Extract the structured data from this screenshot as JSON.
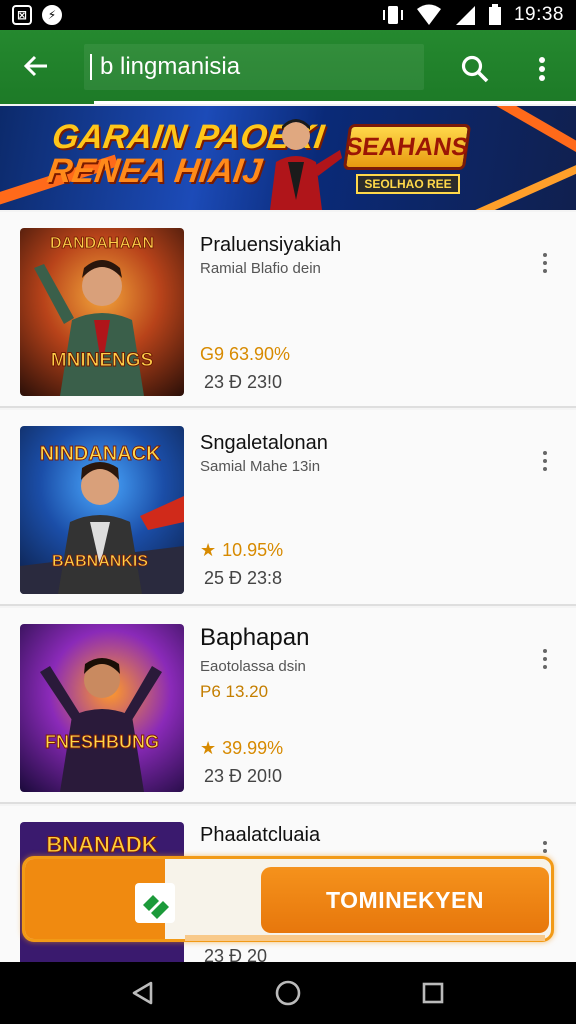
{
  "status_bar": {
    "time": "19:38",
    "left_icons": [
      "notification-box-icon",
      "notification-circle-icon"
    ],
    "right_icons": [
      "vibrate-icon",
      "wifi-icon",
      "signal-icon",
      "battery-icon"
    ]
  },
  "app_bar": {
    "search_text": "b lingmanisia",
    "accent_color": "#1d7a27",
    "icons": [
      "back-arrow-icon",
      "search-icon",
      "more-vert-icon"
    ]
  },
  "banner": {
    "title_line1": "GARAIN PAOEKI",
    "title_line2": "RENEA HIAIJ",
    "badge_text": "SEAHANS",
    "badge_sub": "SEOLHAO REE"
  },
  "items": [
    {
      "title": "Praluensiyakiah",
      "subtitle": "Ramial Blafio dein",
      "rating": "G9 63.90%",
      "show_star": false,
      "meta": "23 Ð 23!0",
      "thumb_title": "DANDAHAAN",
      "thumb_footer": "MNINENGS"
    },
    {
      "title": "Sngaletalonan",
      "subtitle": "Samial Mahe 13in",
      "rating": "10.95%",
      "show_star": true,
      "meta": "25 Ð 23:8",
      "thumb_title": "NINDANACK",
      "thumb_footer": "BABNANKIS"
    },
    {
      "title": "Baphapan",
      "subtitle": "Eaotolassa dsin",
      "price": "P6 13.20",
      "rating": "39.99%",
      "show_star": true,
      "meta": "23 Ð 20!0",
      "thumb_footer": "FNESHBUNG"
    },
    {
      "title": "Phaalatcluaia",
      "thumb_title": "BNANADK",
      "meta": "23 Ð 20"
    }
  ],
  "cta": {
    "button_label": "TOMINEKYEN",
    "color": "#f08a10"
  },
  "nav_bar": {
    "icons": [
      "nav-back-icon",
      "nav-home-icon",
      "nav-recents-icon"
    ]
  }
}
